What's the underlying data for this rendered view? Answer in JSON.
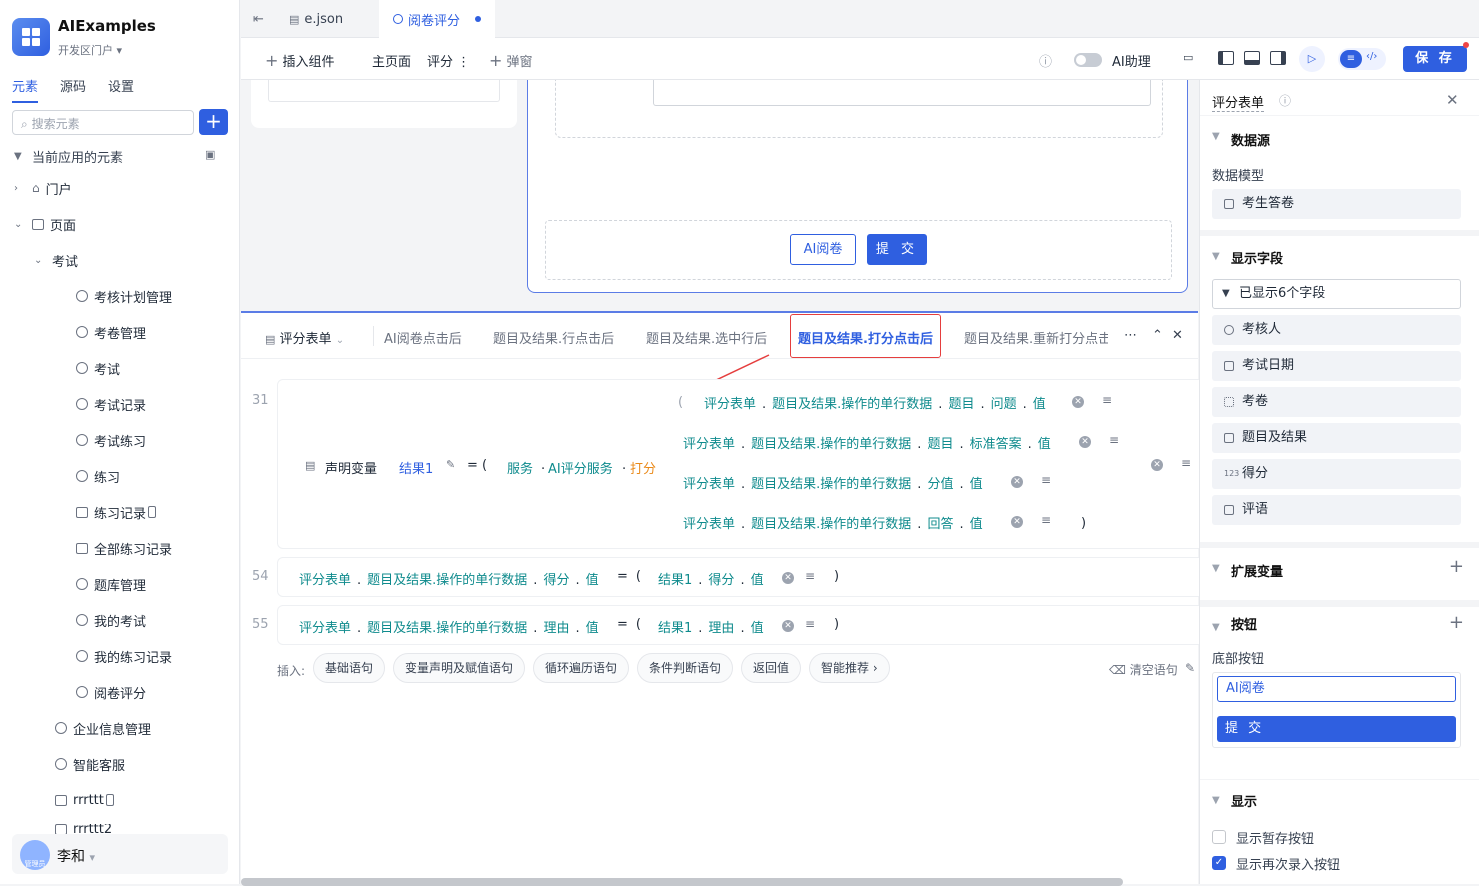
{
  "app": {
    "name": "AIExamples",
    "portal": "开发区门户"
  },
  "side_tabs": [
    "元素",
    "源码",
    "设置"
  ],
  "search": {
    "placeholder": "搜索元素"
  },
  "tree": {
    "root": "当前应用的元素",
    "portal": "门户",
    "pages": "页面",
    "exam_group": "考试",
    "items": [
      "考核计划管理",
      "考卷管理",
      "考试",
      "考试记录",
      "考试练习",
      "练习",
      "练习记录",
      "全部练习记录",
      "题库管理",
      "我的考试",
      "我的练习记录",
      "阅卷评分"
    ],
    "bottom": [
      "企业信息管理",
      "智能客服",
      "rrrttt",
      "rrrttt2"
    ]
  },
  "user": {
    "name": "李和",
    "role": "管理员"
  },
  "file_tabs": {
    "json": "e.json",
    "active": "阅卷评分"
  },
  "toolbar": {
    "insert": "插入组件",
    "main_page": "主页面",
    "score": "评分",
    "popup": "弹窗",
    "ai_assist": "AI助理",
    "save": "保 存"
  },
  "form": {
    "ai_button": "AI阅卷",
    "submit_button": "提 交"
  },
  "events": {
    "selector": "评分表单",
    "tabs": [
      "AI阅卷点击后",
      "题目及结果.行点击后",
      "题目及结果.选中行后",
      "题目及结果.打分点击后",
      "题目及结果.重新打分点击"
    ],
    "active_tab": "题目及结果.打分点击后"
  },
  "code": {
    "line31": "31",
    "line54": "54",
    "line55": "55",
    "declare": "声明变量",
    "var_name": "结果1",
    "eq": "=",
    "lparen": "(",
    "rparen": ")",
    "service": "服务",
    "dot": ".",
    "ai_service": "AI评分服务",
    "score_fn": "打分",
    "form": "评分表单",
    "row_data": "题目及结果.操作的单行数据",
    "topic": "题目",
    "question": "问题",
    "std_answer": "标准答案",
    "score_val": "分值",
    "answer": "回答",
    "value": "值",
    "result_score": "得分",
    "reason": "理由",
    "result1": "结果1"
  },
  "insert_bar": {
    "label": "插入:",
    "chips": [
      "基础语句",
      "变量声明及赋值语句",
      "循环遍历语句",
      "条件判断语句",
      "返回值",
      "智能推荐 ›"
    ],
    "clear": "清空语句"
  },
  "right_panel": {
    "title": "评分表单",
    "datasource": "数据源",
    "model_label": "数据模型",
    "model": "考生答卷",
    "display_fields": "显示字段",
    "fields_shown": "已显示6个字段",
    "fields": [
      "考核人",
      "考试日期",
      "考卷",
      "题目及结果",
      "得分",
      "评语"
    ],
    "ext_vars": "扩展变量",
    "buttons": "按钮",
    "bottom_buttons": "底部按钮",
    "btn_ai": "AI阅卷",
    "btn_submit": "提 交",
    "display": "显示",
    "show_draft": "显示暂存按钮",
    "show_again": "显示再次录入按钮",
    "show_draft_checked": false,
    "show_again_checked": true
  },
  "colors": {
    "accent": "#2f5fe0",
    "teal": "#0f8b8d",
    "orange": "#ea8a1a",
    "highlight": "#e53e3e"
  }
}
